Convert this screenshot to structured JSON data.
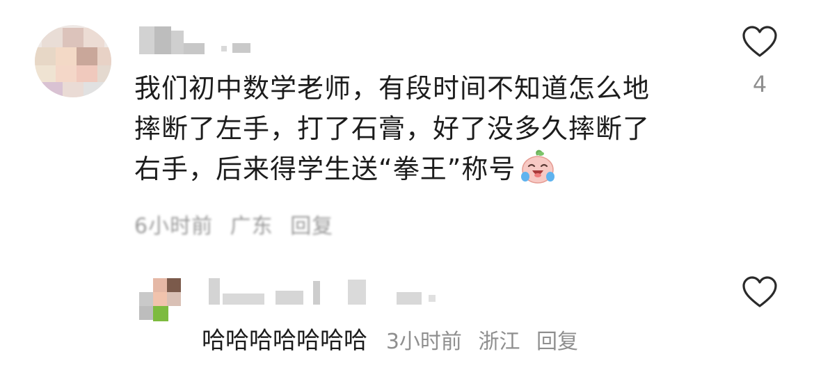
{
  "comment": {
    "lines": [
      "我们初中数学老师，有段时间不知道怎么地",
      "摔断了左手，打了石膏，好了没多久摔断了",
      "右手，后来得学生送“拳王”称号"
    ],
    "emoji": "laughing-crying-peach-emoji",
    "meta": {
      "time": "6小时前",
      "location": "广东",
      "reply_label": "回复"
    },
    "like_count": "4"
  },
  "reply": {
    "text": "哈哈哈哈哈哈哈",
    "time": "3小时前",
    "location": "浙江",
    "reply_label": "回复"
  },
  "icons": {
    "like": "heart-outline-icon"
  },
  "colors": {
    "text": "#1c1c1c",
    "meta": "#8f8f8f",
    "icon": "#2a2a2a"
  }
}
